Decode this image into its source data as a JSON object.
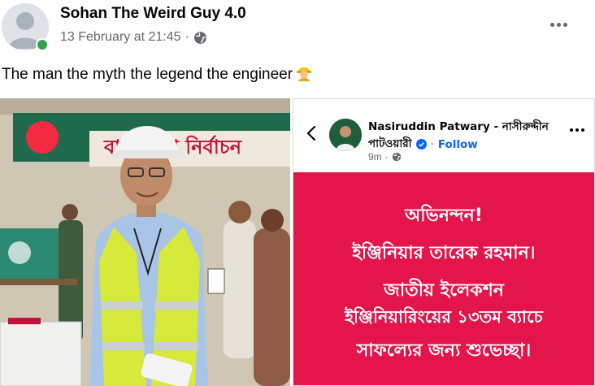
{
  "post": {
    "author": "Sohan The Weird Guy 4.0",
    "date": "13 February at 21:45",
    "dot": "·",
    "privacy_icon": "globe-icon",
    "caption": "The man the myth the legend the engineer",
    "caption_emoji": "👷"
  },
  "shared_post": {
    "name_line1": "Nasiruddin Patwary - নাসীরুদ্দীন",
    "name_line2": "পাটওয়ারী",
    "separator": "·",
    "follow_label": "Follow",
    "time": "9m",
    "time_dot": "·",
    "message_lines": [
      "অভিনন্দন!",
      "ইঞ্জিনিয়ার তারেক রহমান।",
      "জাতীয় ইলেকশন",
      "ইঞ্জিনিয়ারিংয়ের ১৩তম ব্যাচে",
      "সাফল্যের জন্য শুভেচ্ছা।"
    ],
    "card_color": "#e4154b"
  },
  "photo": {
    "banner_text": "বাংলাদেশ নির্বাচন",
    "flag_colors": [
      "#006a4e",
      "#f42a41"
    ],
    "vest_color": "#d7e93a",
    "helmet_color": "#f4f4f4"
  },
  "colors": {
    "accent": "#0866ff",
    "online": "#31a24c",
    "muted": "#65676b"
  }
}
